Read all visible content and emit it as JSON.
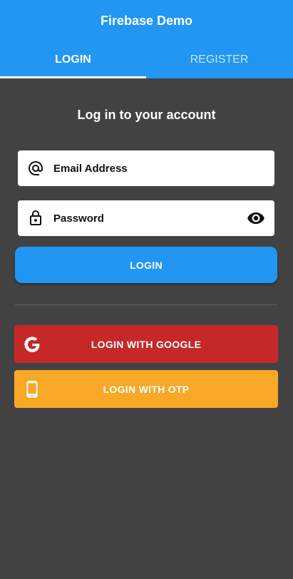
{
  "appbar": {
    "title": "Firebase Demo"
  },
  "tabs": [
    {
      "label": "LOGIN",
      "active": true
    },
    {
      "label": "REGISTER",
      "active": false
    }
  ],
  "login": {
    "heading": "Log in to your account",
    "email": {
      "placeholder": "Email Address",
      "value": "",
      "icon": "at-icon"
    },
    "password": {
      "placeholder": "Password",
      "value": "",
      "icon": "lock-icon",
      "toggle_icon": "eye-icon"
    },
    "login_button": "LOGIN",
    "google_button": "LOGIN WITH GOOGLE",
    "otp_button": "LOGIN WITH OTP"
  },
  "colors": {
    "primary": "#2196f3",
    "background": "#424242",
    "google": "#c62828",
    "otp": "#f9a825"
  }
}
